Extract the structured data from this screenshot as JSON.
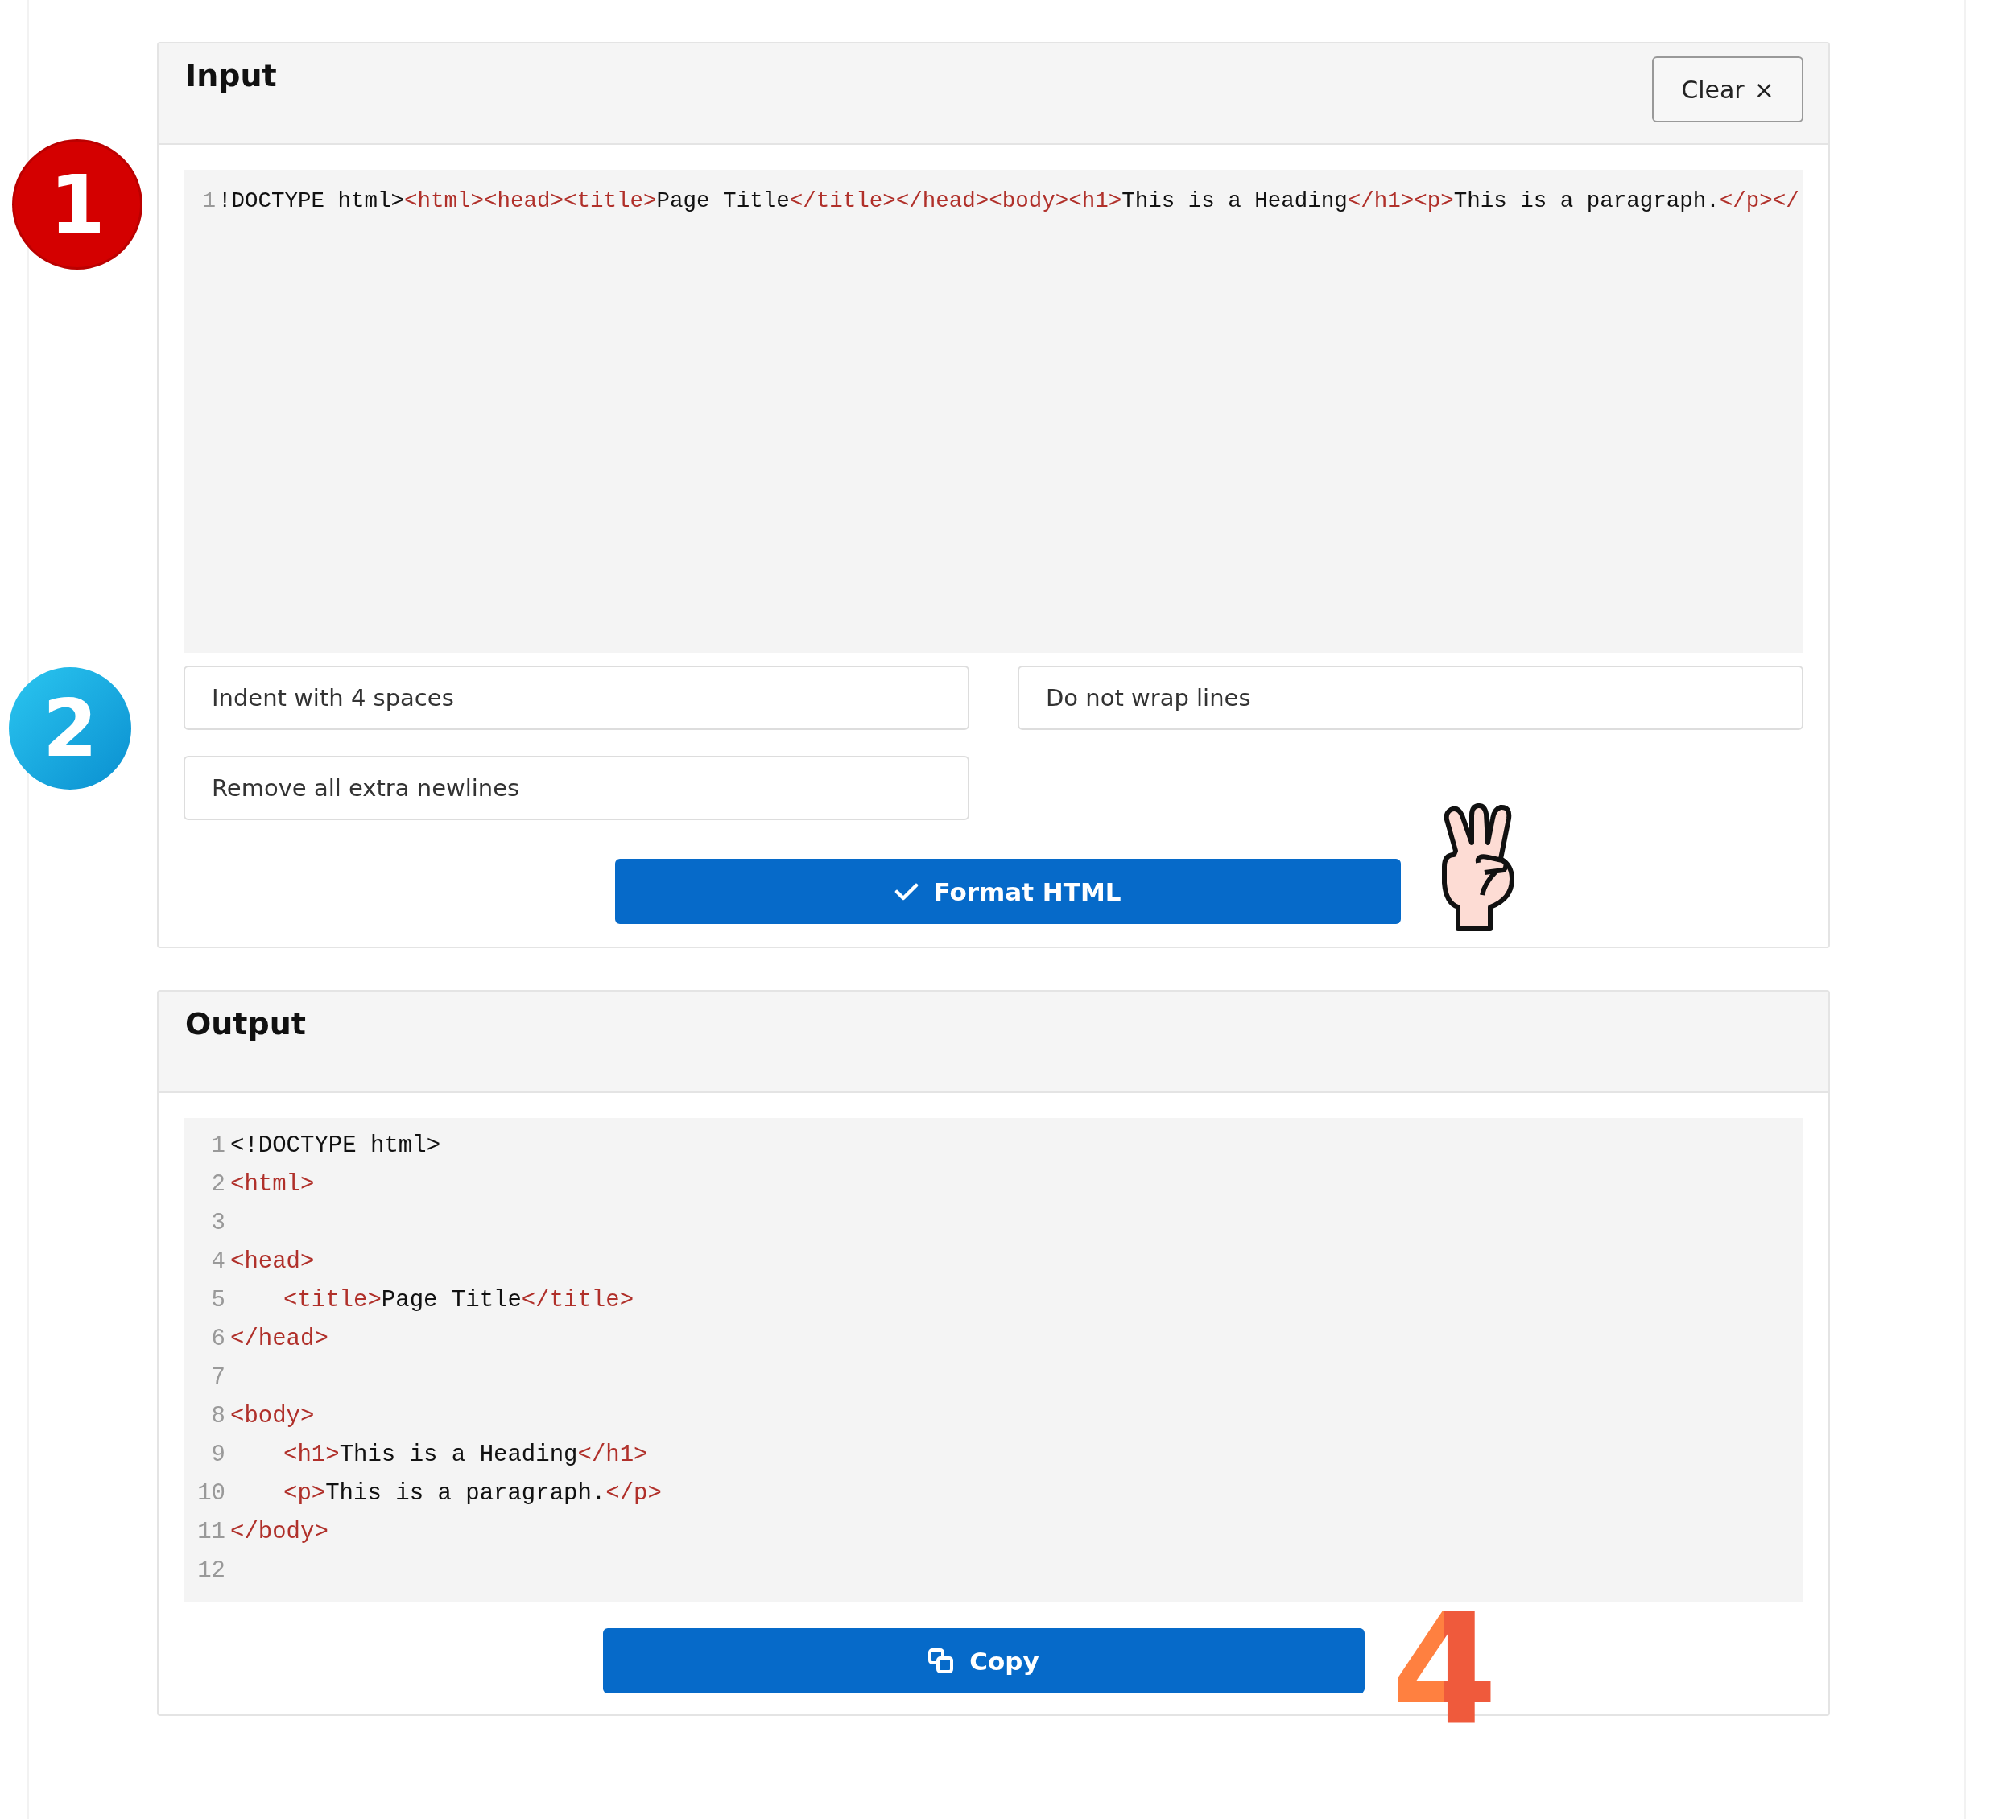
{
  "markers": [
    {
      "text": "1",
      "kind": "red"
    },
    {
      "text": "2",
      "kind": "blue"
    },
    {
      "text": "4",
      "kind": "orange"
    }
  ],
  "input": {
    "title": "Input",
    "clear_button": "Clear",
    "clear_icon": "×",
    "lines": [
      {
        "number": "1",
        "segments": [
          {
            "kind": "text",
            "text": "!DOCTYPE html>"
          },
          {
            "kind": "tag",
            "text": "<html><head><title>"
          },
          {
            "kind": "text",
            "text": "Page Title"
          },
          {
            "kind": "tag",
            "text": "</title></head><body><h1>"
          },
          {
            "kind": "text",
            "text": "This is a Heading"
          },
          {
            "kind": "tag",
            "text": "</h1><p>"
          },
          {
            "kind": "text",
            "text": "This is a paragraph."
          },
          {
            "kind": "tag",
            "text": "</p></"
          }
        ]
      }
    ],
    "options": [
      "Indent with 4 spaces",
      "Do not wrap lines",
      "Remove all extra newlines"
    ],
    "format_button": "Format HTML"
  },
  "output": {
    "title": "Output",
    "lines": [
      {
        "number": "1",
        "indented": false,
        "segments": [
          {
            "kind": "text",
            "text": "<!DOCTYPE html>"
          }
        ]
      },
      {
        "number": "2",
        "indented": false,
        "segments": [
          {
            "kind": "tag",
            "text": "<html>"
          }
        ]
      },
      {
        "number": "3"
      },
      {
        "number": "4",
        "indented": false,
        "segments": [
          {
            "kind": "tag",
            "text": "<head>"
          }
        ]
      },
      {
        "number": "5",
        "indented": true,
        "segments": [
          {
            "kind": "tag",
            "text": "<title>"
          },
          {
            "kind": "text",
            "text": "Page Title"
          },
          {
            "kind": "tag",
            "text": "</title>"
          }
        ]
      },
      {
        "number": "6",
        "indented": false,
        "segments": [
          {
            "kind": "tag",
            "text": "</head>"
          }
        ]
      },
      {
        "number": "7"
      },
      {
        "number": "8",
        "indented": false,
        "segments": [
          {
            "kind": "tag",
            "text": "<body>"
          }
        ]
      },
      {
        "number": "9",
        "indented": true,
        "segments": [
          {
            "kind": "tag",
            "text": "<h1>"
          },
          {
            "kind": "text",
            "text": "This is a Heading"
          },
          {
            "kind": "tag",
            "text": "</h1>"
          }
        ]
      },
      {
        "number": "10",
        "indented": true,
        "segments": [
          {
            "kind": "tag",
            "text": "<p>"
          },
          {
            "kind": "text",
            "text": "This is a paragraph."
          },
          {
            "kind": "tag",
            "text": "</p>"
          }
        ]
      },
      {
        "number": "11",
        "indented": false,
        "segments": [
          {
            "kind": "tag",
            "text": "</body>"
          }
        ]
      },
      {
        "number": "12"
      }
    ],
    "copy_button": "Copy"
  }
}
